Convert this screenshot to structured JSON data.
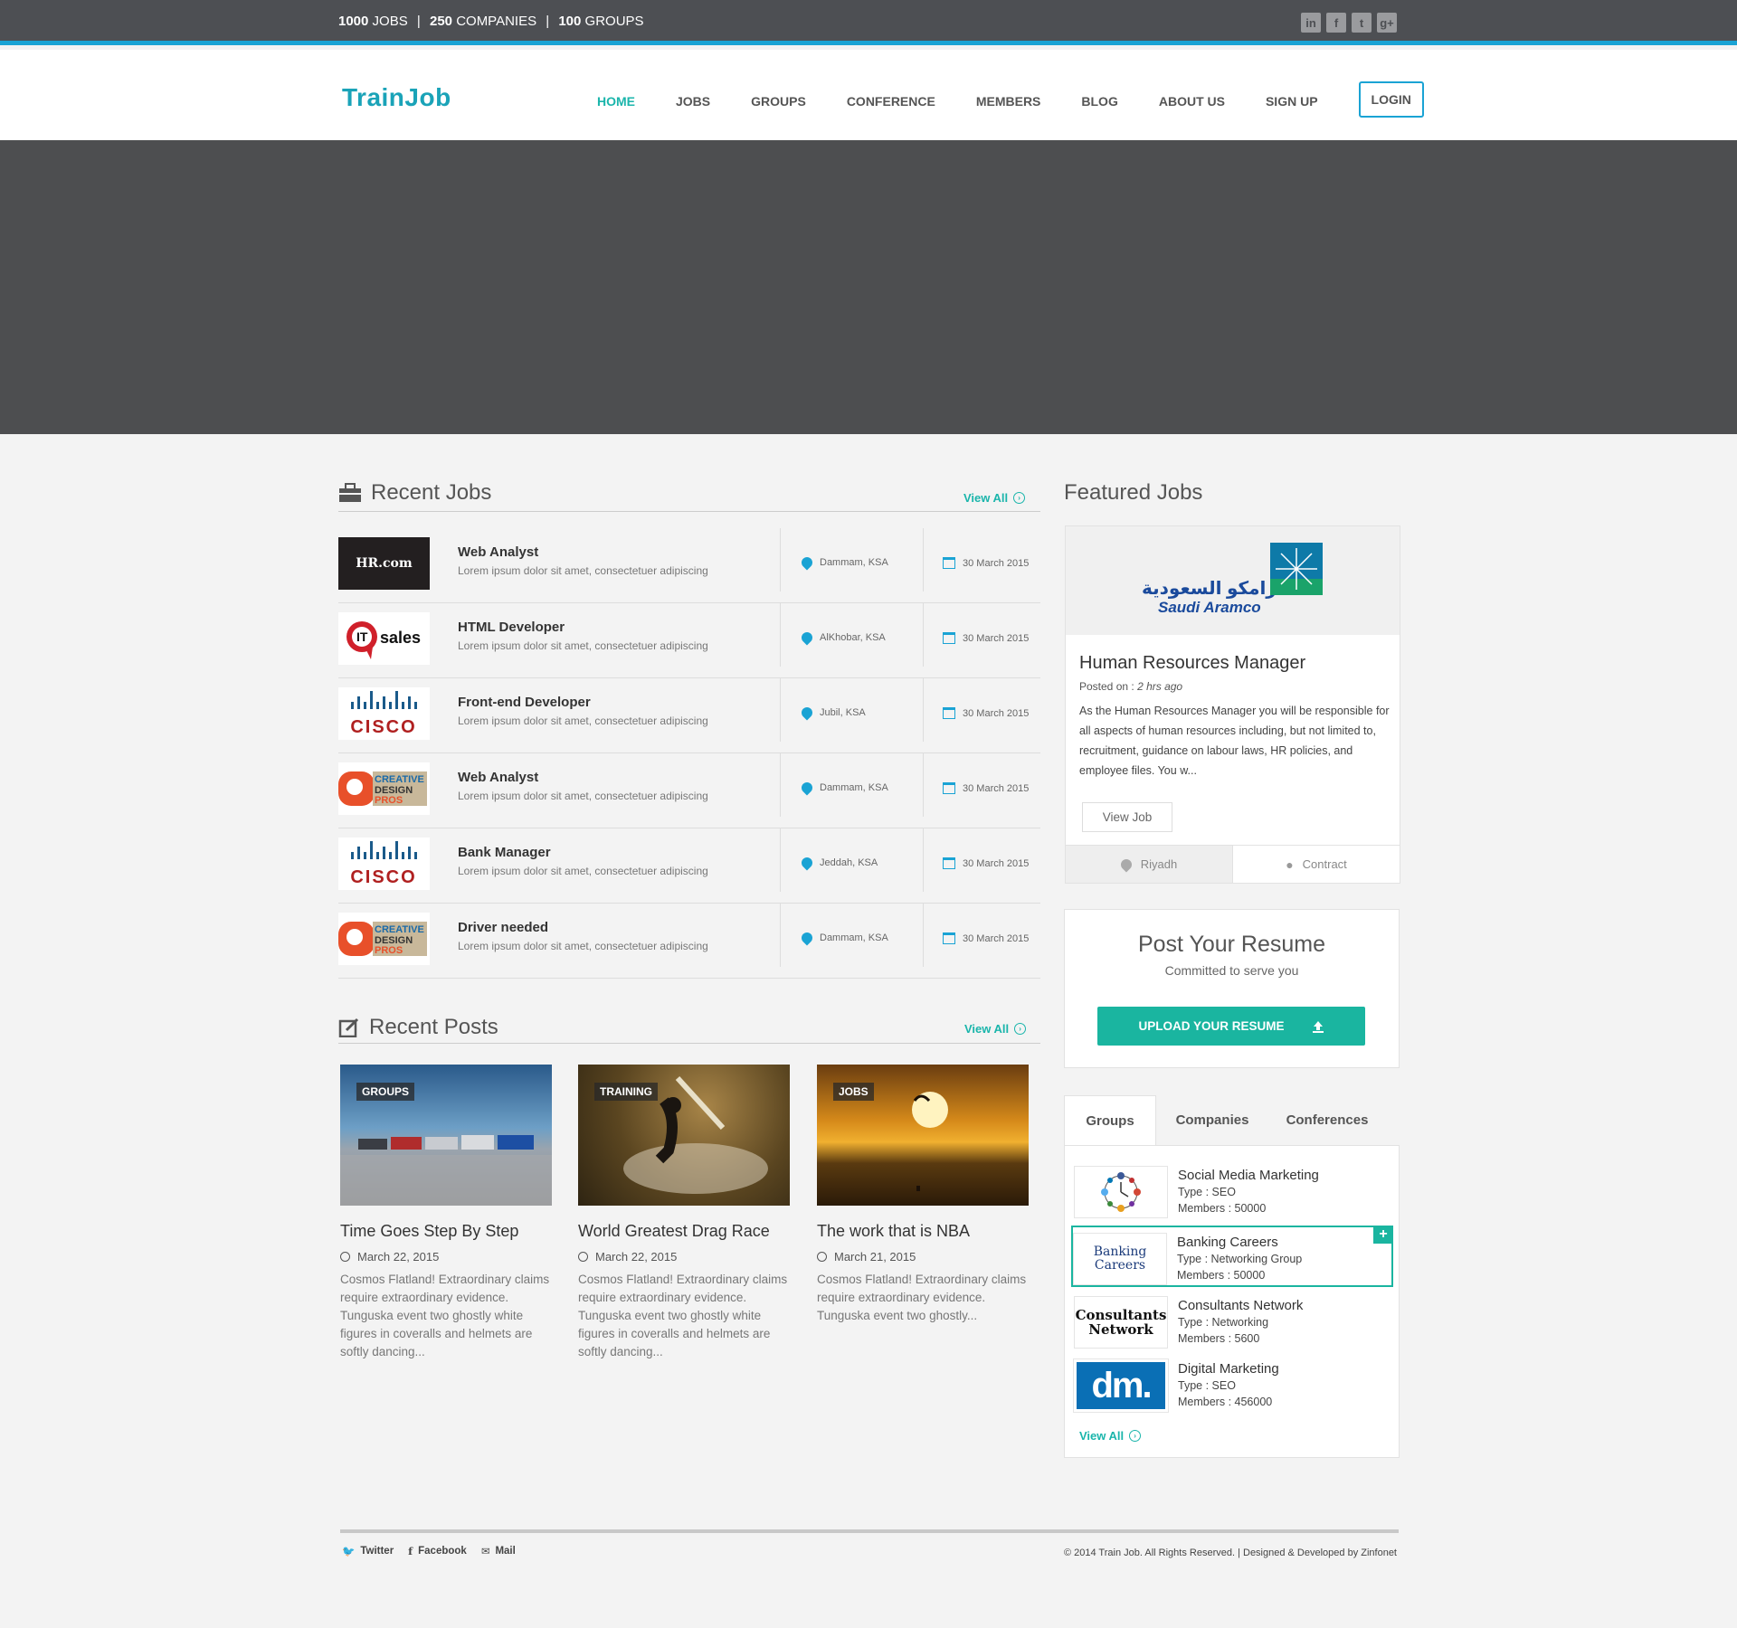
{
  "topbar": {
    "jobs_count": "1000",
    "jobs_label": "JOBS",
    "companies_count": "250",
    "companies_label": "COMPANIES",
    "groups_count": "100",
    "groups_label": "GROUPS",
    "separator": "|",
    "social": [
      "in",
      "f",
      "t",
      "g+"
    ]
  },
  "header": {
    "logo": "TrainJob",
    "nav": [
      "HOME",
      "JOBS",
      "GROUPS",
      "CONFERENCE",
      "MEMBERS",
      "BLOG",
      "ABOUT US",
      "SIGN UP"
    ],
    "login": "LOGIN"
  },
  "recent_jobs": {
    "title": "Recent Jobs",
    "view_all": "View All",
    "items": [
      {
        "title": "Web Analyst",
        "desc": "Lorem ipsum dolor sit amet, consectetuer adipiscing",
        "location": "Dammam, KSA",
        "date": "30 March 2015",
        "logo": "HR.com"
      },
      {
        "title": "HTML Developer",
        "desc": "Lorem ipsum dolor sit amet, consectetuer adipiscing",
        "location": "AlKhobar, KSA",
        "date": "30 March 2015",
        "logo": "IT sales"
      },
      {
        "title": "Front-end Developer",
        "desc": "Lorem ipsum dolor sit amet, consectetuer adipiscing",
        "location": "Jubil, KSA",
        "date": "30 March 2015",
        "logo": "CISCO"
      },
      {
        "title": "Web Analyst",
        "desc": "Lorem ipsum dolor sit amet, consectetuer adipiscing",
        "location": "Dammam, KSA",
        "date": "30 March 2015",
        "logo": "CREATIVE DESIGN PROS"
      },
      {
        "title": "Bank Manager",
        "desc": "Lorem ipsum dolor sit amet, consectetuer adipiscing",
        "location": "Jeddah, KSA",
        "date": "30 March 2015",
        "logo": "CISCO"
      },
      {
        "title": "Driver needed",
        "desc": "Lorem ipsum dolor sit amet, consectetuer adipiscing",
        "location": "Dammam, KSA",
        "date": "30 March 2015",
        "logo": "CREATIVE DESIGN PROS"
      }
    ]
  },
  "recent_posts": {
    "title": "Recent Posts",
    "view_all": "View All",
    "items": [
      {
        "tag": "GROUPS",
        "title": "Time Goes Step By Step",
        "date": "March 22, 2015",
        "body": "Cosmos Flatland! Extraordinary claims require extraordinary evidence. Tunguska event two ghostly white figures in coveralls and helmets are softly dancing..."
      },
      {
        "tag": "TRAINING",
        "title": "World Greatest Drag Race",
        "date": "March 22, 2015",
        "body": "Cosmos Flatland! Extraordinary claims require extraordinary evidence. Tunguska event two ghostly white figures in coveralls and helmets are softly dancing..."
      },
      {
        "tag": "JOBS",
        "title": "The work that is NBA",
        "date": "March 21, 2015",
        "body": "Cosmos Flatland! Extraordinary claims require extraordinary evidence. Tunguska event two ghostly..."
      }
    ]
  },
  "featured": {
    "title": "Featured Jobs",
    "company_ar": "ارامكو السعودية",
    "company_en": "Saudi Aramco",
    "job_title": "Human Resources Manager",
    "posted_label": "Posted on :",
    "posted_value": "2 hrs ago",
    "body": "As the Human Resources Manager you will be responsible for all aspects of human resources including, but not limited to, recruitment, guidance on labour laws, HR policies, and employee files. You w...",
    "button": "View Job",
    "location": "Riyadh",
    "type": "Contract"
  },
  "resume": {
    "title": "Post Your Resume",
    "subtitle": "Committed to serve you",
    "button": "UPLOAD YOUR RESUME"
  },
  "tabs": {
    "labels": [
      "Groups",
      "Companies",
      "Conferences"
    ],
    "groups": [
      {
        "name": "Social Media Marketing",
        "type": "Type : SEO",
        "members": "Members : 50000"
      },
      {
        "name": "Banking Careers",
        "type": "Type : Networking Group",
        "members": "Members : 50000",
        "logo": "Banking Careers"
      },
      {
        "name": "Consultants Network",
        "type": "Type : Networking",
        "members": "Members : 5600",
        "logo": "Consultants Network"
      },
      {
        "name": "Digital Marketing",
        "type": "Type : SEO",
        "members": "Members : 456000",
        "logo": "dm."
      }
    ],
    "view_all": "View All",
    "plus": "+"
  },
  "footer": {
    "links": [
      "Twitter",
      "Facebook",
      "Mail"
    ],
    "copyright": "© 2014 Train Job.  All Rights Reserved. | Designed & Developed by Zinfonet"
  },
  "colors": {
    "accent": "#1ab5a0",
    "blue": "#1aa3d4",
    "dark": "#4d4f53"
  }
}
